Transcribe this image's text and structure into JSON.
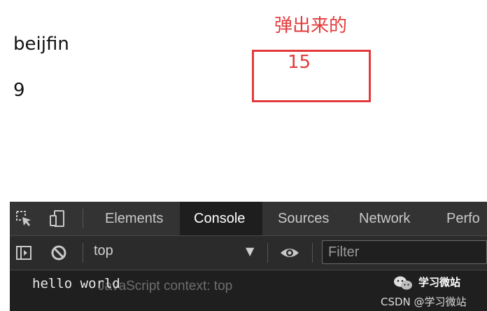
{
  "page": {
    "line1": "beijfin",
    "line2": "9"
  },
  "annotation": {
    "title": "弹出来的",
    "value": "15",
    "color": "#e33b3b"
  },
  "devtools": {
    "tabs": [
      {
        "label": "Elements",
        "active": false
      },
      {
        "label": "Console",
        "active": true
      },
      {
        "label": "Sources",
        "active": false
      },
      {
        "label": "Network",
        "active": false
      },
      {
        "label": "Perfo",
        "active": false
      }
    ],
    "toolbar": {
      "context": "top",
      "filter_placeholder": "Filter"
    },
    "console": {
      "log": "hello world",
      "hint": "JavaScript context: top"
    },
    "icons": [
      "inspect-icon",
      "device-toolbar-icon",
      "sidebar-toggle-icon",
      "clear-console-icon",
      "eye-icon",
      "wechat-icon"
    ]
  },
  "watermark": {
    "label": "学习微站",
    "csdn": "CSDN @学习微站"
  }
}
